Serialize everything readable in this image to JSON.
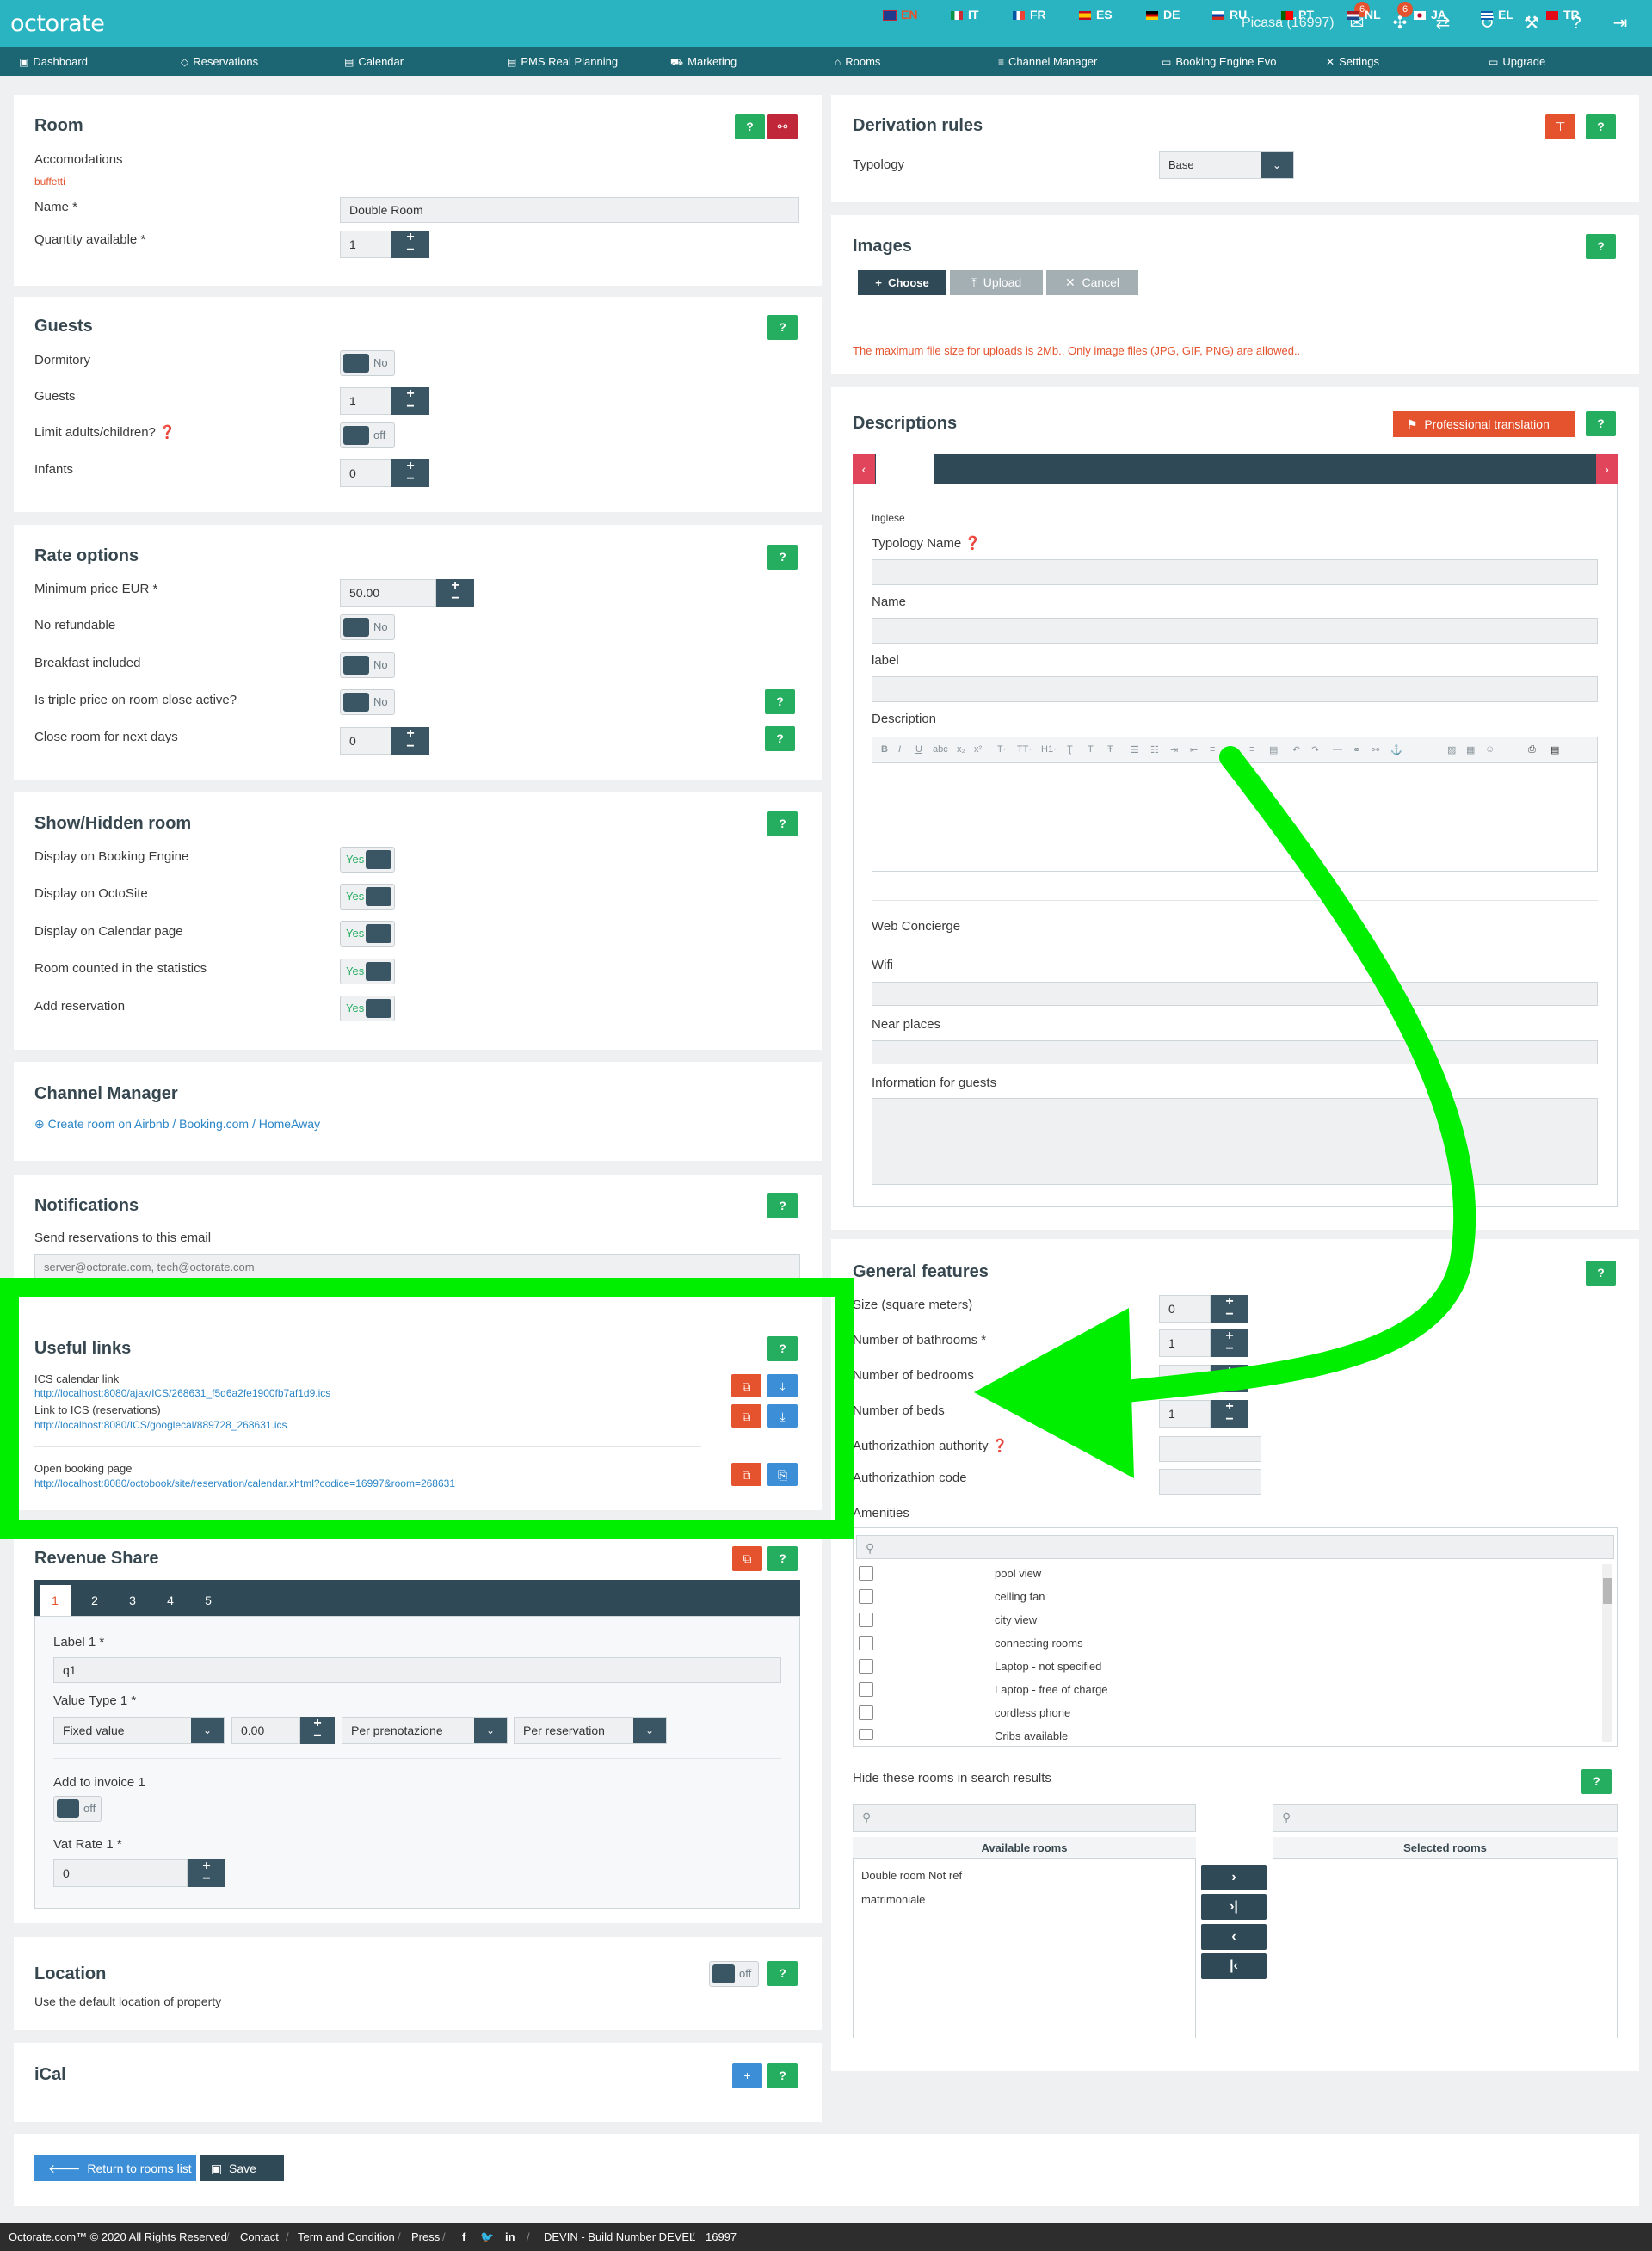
{
  "topbar": {
    "logo": "octorate",
    "user": "Picasa (16997)",
    "notif1": "6",
    "notif2": "6"
  },
  "nav": [
    "Dashboard",
    "Reservations",
    "Calendar",
    "PMS Real Planning",
    "Marketing",
    "Rooms",
    "Channel Manager",
    "Booking Engine Evo",
    "Settings",
    "Upgrade"
  ],
  "room": {
    "title": "Room",
    "accom_label": "Accomodations",
    "accom_value": "buffetti",
    "name_label": "Name",
    "name_value": "Double Room",
    "qty_label": "Quantity available",
    "qty_value": "1"
  },
  "guests": {
    "title": "Guests",
    "dormitory": "Dormitory",
    "dormitory_val": "No",
    "guests": "Guests",
    "guests_val": "1",
    "limit": "Limit adults/children?",
    "limit_val": "off",
    "infants": "Infants",
    "infants_val": "0"
  },
  "rate": {
    "title": "Rate options",
    "min_price": "Minimum price EUR",
    "min_price_val": "50.00",
    "no_refund": "No refundable",
    "no_refund_val": "No",
    "breakfast": "Breakfast included",
    "breakfast_val": "No",
    "triple": "Is triple price on room close active?",
    "triple_val": "No",
    "close_room": "Close room for next days",
    "close_room_val": "0"
  },
  "show": {
    "title": "Show/Hidden room",
    "items": [
      "Display on Booking Engine",
      "Display on OctoSite",
      "Display on Calendar page",
      "Room counted in the statistics",
      "Add reservation"
    ],
    "val": "Yes"
  },
  "channel": {
    "title": "Channel Manager",
    "link": "Create room on Airbnb / Booking.com / HomeAway"
  },
  "notif": {
    "title": "Notifications",
    "label": "Send reservations to this email",
    "placeholder": "server@octorate.com, tech@octorate.com"
  },
  "useful": {
    "title": "Useful links",
    "ics_label": "ICS calendar link",
    "ics_url": "http://localhost:8080/ajax/ICS/268631_f5d6a2fe1900fb7af1d9.ics",
    "ics2_label": "Link to ICS (reservations)",
    "ics2_url": "http://localhost:8080/ICS/googlecal/889728_268631.ics",
    "open_label": "Open booking page",
    "open_url": "http://localhost:8080/octobook/site/reservation/calendar.xhtml?codice=16997&room=268631"
  },
  "revenue": {
    "title": "Revenue Share",
    "tabs": [
      "1",
      "2",
      "3",
      "4",
      "5"
    ],
    "label_lbl": "Label 1",
    "label_val": "q1",
    "vt_lbl": "Value Type 1",
    "vt_sel": "Fixed value",
    "vt_num": "0.00",
    "vt_per": "Per prenotazione",
    "vt_per2": "Per reservation",
    "add_inv": "Add to invoice 1",
    "add_inv_val": "off",
    "vat": "Vat Rate 1",
    "vat_val": "0"
  },
  "location": {
    "title": "Location",
    "text": "Use the default location of property",
    "val": "off"
  },
  "ical": {
    "title": "iCal"
  },
  "buttons": {
    "return": "Return to rooms list",
    "save": "Save"
  },
  "deriv": {
    "title": "Derivation rules",
    "typology": "Typology",
    "typology_val": "Base"
  },
  "images": {
    "title": "Images",
    "choose": "Choose",
    "upload": "Upload",
    "cancel": "Cancel",
    "note": "The maximum file size for uploads is 2Mb.. Only image files (JPG, GIF, PNG) are allowed.."
  },
  "desc": {
    "title": "Descriptions",
    "translate": "Professional translation",
    "langs": [
      "EN",
      "IT",
      "FR",
      "ES",
      "DE",
      "RU",
      "PT",
      "NL",
      "JA",
      "EL",
      "TR"
    ],
    "lang_name": "Inglese",
    "typ_name": "Typology Name",
    "name": "Name",
    "label": "label",
    "description": "Description",
    "web": "Web Concierge",
    "wifi": "Wifi",
    "near": "Near places",
    "info": "Information for guests"
  },
  "general": {
    "title": "General features",
    "size": "Size (square meters)",
    "size_val": "0",
    "bath": "Number of bathrooms",
    "bath_val": "1",
    "bed": "Number of bedrooms",
    "beds": "Number of beds",
    "beds_val": "1",
    "auth": "Authorizathion authority",
    "code": "Authorizathion code",
    "amenities": "Amenities",
    "amen_list": [
      "pool view",
      "ceiling fan",
      "city view",
      "connecting rooms",
      "Laptop - not specified",
      "Laptop - free of charge",
      "cordless phone",
      "Cribs available"
    ]
  },
  "hide": {
    "title": "Hide these rooms in search results",
    "available": "Available rooms",
    "selected": "Selected rooms",
    "rooms": [
      "Double room Not ref",
      "matrimoniale"
    ]
  },
  "footer": {
    "copy": "Octorate.com™ © 2020 All Rights Reserved",
    "contact": "Contact",
    "terms": "Term and Condition",
    "press": "Press",
    "build": "DEVIN - Build Number DEVEL",
    "num": "16997"
  },
  "colors": {
    "teal": "#2ab3c0",
    "nav": "#1b6672",
    "green": "#26ae60",
    "red": "#e4532d",
    "highlight": "#00ee00"
  }
}
